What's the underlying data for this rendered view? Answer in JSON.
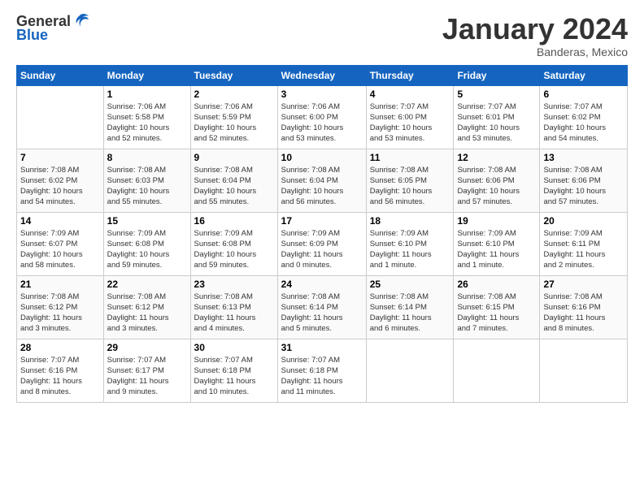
{
  "logo": {
    "text1": "General",
    "text2": "Blue"
  },
  "header": {
    "month": "January 2024",
    "location": "Banderas, Mexico"
  },
  "days_of_week": [
    "Sunday",
    "Monday",
    "Tuesday",
    "Wednesday",
    "Thursday",
    "Friday",
    "Saturday"
  ],
  "weeks": [
    [
      {
        "day": "",
        "info": ""
      },
      {
        "day": "1",
        "info": "Sunrise: 7:06 AM\nSunset: 5:58 PM\nDaylight: 10 hours\nand 52 minutes."
      },
      {
        "day": "2",
        "info": "Sunrise: 7:06 AM\nSunset: 5:59 PM\nDaylight: 10 hours\nand 52 minutes."
      },
      {
        "day": "3",
        "info": "Sunrise: 7:06 AM\nSunset: 6:00 PM\nDaylight: 10 hours\nand 53 minutes."
      },
      {
        "day": "4",
        "info": "Sunrise: 7:07 AM\nSunset: 6:00 PM\nDaylight: 10 hours\nand 53 minutes."
      },
      {
        "day": "5",
        "info": "Sunrise: 7:07 AM\nSunset: 6:01 PM\nDaylight: 10 hours\nand 53 minutes."
      },
      {
        "day": "6",
        "info": "Sunrise: 7:07 AM\nSunset: 6:02 PM\nDaylight: 10 hours\nand 54 minutes."
      }
    ],
    [
      {
        "day": "7",
        "info": "Sunrise: 7:08 AM\nSunset: 6:02 PM\nDaylight: 10 hours\nand 54 minutes."
      },
      {
        "day": "8",
        "info": "Sunrise: 7:08 AM\nSunset: 6:03 PM\nDaylight: 10 hours\nand 55 minutes."
      },
      {
        "day": "9",
        "info": "Sunrise: 7:08 AM\nSunset: 6:04 PM\nDaylight: 10 hours\nand 55 minutes."
      },
      {
        "day": "10",
        "info": "Sunrise: 7:08 AM\nSunset: 6:04 PM\nDaylight: 10 hours\nand 56 minutes."
      },
      {
        "day": "11",
        "info": "Sunrise: 7:08 AM\nSunset: 6:05 PM\nDaylight: 10 hours\nand 56 minutes."
      },
      {
        "day": "12",
        "info": "Sunrise: 7:08 AM\nSunset: 6:06 PM\nDaylight: 10 hours\nand 57 minutes."
      },
      {
        "day": "13",
        "info": "Sunrise: 7:08 AM\nSunset: 6:06 PM\nDaylight: 10 hours\nand 57 minutes."
      }
    ],
    [
      {
        "day": "14",
        "info": "Sunrise: 7:09 AM\nSunset: 6:07 PM\nDaylight: 10 hours\nand 58 minutes."
      },
      {
        "day": "15",
        "info": "Sunrise: 7:09 AM\nSunset: 6:08 PM\nDaylight: 10 hours\nand 59 minutes."
      },
      {
        "day": "16",
        "info": "Sunrise: 7:09 AM\nSunset: 6:08 PM\nDaylight: 10 hours\nand 59 minutes."
      },
      {
        "day": "17",
        "info": "Sunrise: 7:09 AM\nSunset: 6:09 PM\nDaylight: 11 hours\nand 0 minutes."
      },
      {
        "day": "18",
        "info": "Sunrise: 7:09 AM\nSunset: 6:10 PM\nDaylight: 11 hours\nand 1 minute."
      },
      {
        "day": "19",
        "info": "Sunrise: 7:09 AM\nSunset: 6:10 PM\nDaylight: 11 hours\nand 1 minute."
      },
      {
        "day": "20",
        "info": "Sunrise: 7:09 AM\nSunset: 6:11 PM\nDaylight: 11 hours\nand 2 minutes."
      }
    ],
    [
      {
        "day": "21",
        "info": "Sunrise: 7:08 AM\nSunset: 6:12 PM\nDaylight: 11 hours\nand 3 minutes."
      },
      {
        "day": "22",
        "info": "Sunrise: 7:08 AM\nSunset: 6:12 PM\nDaylight: 11 hours\nand 3 minutes."
      },
      {
        "day": "23",
        "info": "Sunrise: 7:08 AM\nSunset: 6:13 PM\nDaylight: 11 hours\nand 4 minutes."
      },
      {
        "day": "24",
        "info": "Sunrise: 7:08 AM\nSunset: 6:14 PM\nDaylight: 11 hours\nand 5 minutes."
      },
      {
        "day": "25",
        "info": "Sunrise: 7:08 AM\nSunset: 6:14 PM\nDaylight: 11 hours\nand 6 minutes."
      },
      {
        "day": "26",
        "info": "Sunrise: 7:08 AM\nSunset: 6:15 PM\nDaylight: 11 hours\nand 7 minutes."
      },
      {
        "day": "27",
        "info": "Sunrise: 7:08 AM\nSunset: 6:16 PM\nDaylight: 11 hours\nand 8 minutes."
      }
    ],
    [
      {
        "day": "28",
        "info": "Sunrise: 7:07 AM\nSunset: 6:16 PM\nDaylight: 11 hours\nand 8 minutes."
      },
      {
        "day": "29",
        "info": "Sunrise: 7:07 AM\nSunset: 6:17 PM\nDaylight: 11 hours\nand 9 minutes."
      },
      {
        "day": "30",
        "info": "Sunrise: 7:07 AM\nSunset: 6:18 PM\nDaylight: 11 hours\nand 10 minutes."
      },
      {
        "day": "31",
        "info": "Sunrise: 7:07 AM\nSunset: 6:18 PM\nDaylight: 11 hours\nand 11 minutes."
      },
      {
        "day": "",
        "info": ""
      },
      {
        "day": "",
        "info": ""
      },
      {
        "day": "",
        "info": ""
      }
    ]
  ]
}
